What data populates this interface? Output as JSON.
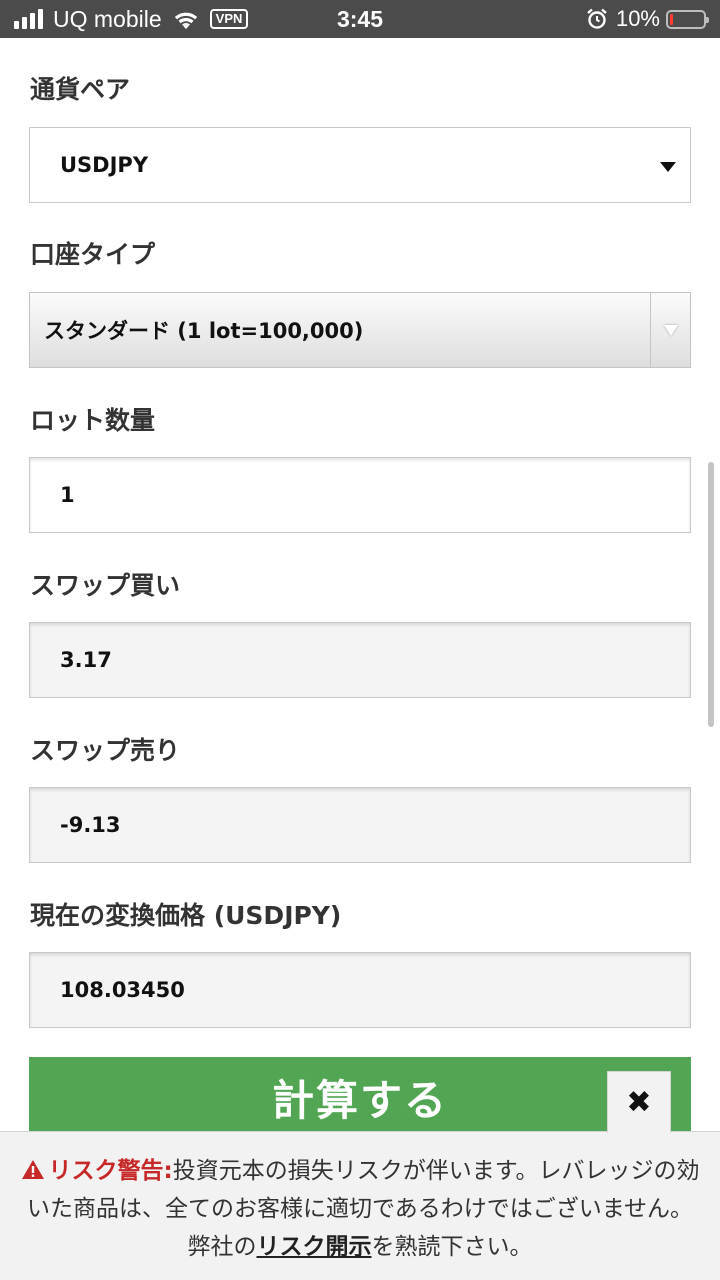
{
  "status_bar": {
    "carrier": "UQ mobile",
    "vpn": "VPN",
    "time": "3:45",
    "battery": "10%",
    "battery_level": 0.1,
    "icons": [
      "signal-icon",
      "wifi-icon",
      "alarm-icon",
      "battery-icon"
    ]
  },
  "form": {
    "currency_pair": {
      "label": "通貨ペア",
      "value": "USDJPY"
    },
    "account_type": {
      "label": "口座タイプ",
      "value": "スタンダード (1 lot=100,000)"
    },
    "lot_quantity": {
      "label": "ロット数量",
      "value": "1"
    },
    "swap_buy": {
      "label": "スワップ買い",
      "value": "3.17"
    },
    "swap_sell": {
      "label": "スワップ売り",
      "value": "-9.13"
    },
    "conversion_rate": {
      "label": "現在の変換価格 (USDJPY)",
      "value": "108.03450"
    }
  },
  "calc_button": {
    "label": "計算する"
  },
  "risk_banner": {
    "title": "リスク警告:",
    "text_before": "投資元本の損失リスクが伴います。レバレッジの効いた商品は、全てのお客様に適切であるわけではございません。弊社の",
    "link": "リスク開示",
    "text_after": "を熟読下さい。",
    "close": "✖"
  },
  "colors": {
    "status_bar": "#4b4b4b",
    "accent_green": "#52a653",
    "warning_red": "#c62828",
    "battery_red": "#ff3b30"
  }
}
